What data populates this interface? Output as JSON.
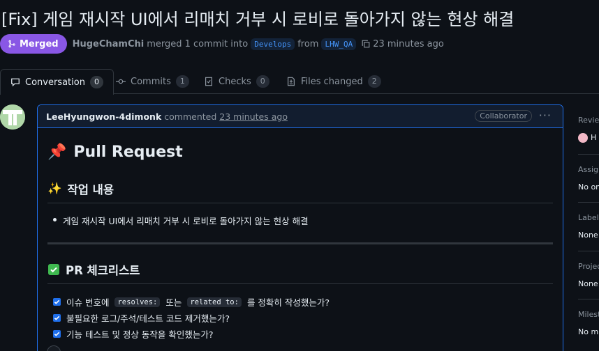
{
  "pr": {
    "title": "[Fix] 게임 재시작 UI에서 리매치 거부 시 로비로 돌아가지 않는 현상 해결",
    "state_label": "Merged",
    "author": "HugeChamChi",
    "merge_text": "merged 1 commit into",
    "base_branch": "Develops",
    "from_text": "from",
    "head_branch": "LHW_QA",
    "time": "23 minutes ago"
  },
  "tabs": [
    {
      "label": "Conversation",
      "count": "0",
      "icon": "comment-icon"
    },
    {
      "label": "Commits",
      "count": "1",
      "icon": "commit-icon"
    },
    {
      "label": "Checks",
      "count": "0",
      "icon": "checklist-icon"
    },
    {
      "label": "Files changed",
      "count": "2",
      "icon": "file-diff-icon"
    }
  ],
  "comment": {
    "author": "LeeHyungwon-4dimonk",
    "verb": "commented",
    "time": "23 minutes ago",
    "role": "Collaborator",
    "h1_emoji": "📌",
    "h1": "Pull Request",
    "sec1_emoji": "✨",
    "sec1_title": "작업 내용",
    "bullets": [
      "게임 재시작 UI에서 리매치 거부 시 로비로 돌아가지 않는 현상 해결"
    ],
    "sec2_title": "PR 체크리스트",
    "checklist": [
      {
        "pre": "이슈 번호에",
        "code1": "resolves:",
        "mid": "또는",
        "code2": "related to:",
        "post": "를 정확히 작성했는가?"
      },
      {
        "text": "불필요한 로그/주석/테스트 코드 제거했는가?"
      },
      {
        "text": "기능 테스트 및 정상 동작을 확인했는가?"
      }
    ]
  },
  "sidebar": {
    "reviewers_label": "Review",
    "reviewer_initial": "H",
    "assignees_label": "Assign",
    "assignees_value": "No on",
    "labels_label": "Labels",
    "labels_value": "None",
    "projects_label": "Projec",
    "projects_value": "None",
    "milestone_label": "Milest",
    "milestone_value": "No mi"
  },
  "colors": {
    "merged": "#8957e5",
    "link": "#4493f8",
    "checkbox": "#1f6feb",
    "bg": "#0d1117"
  }
}
